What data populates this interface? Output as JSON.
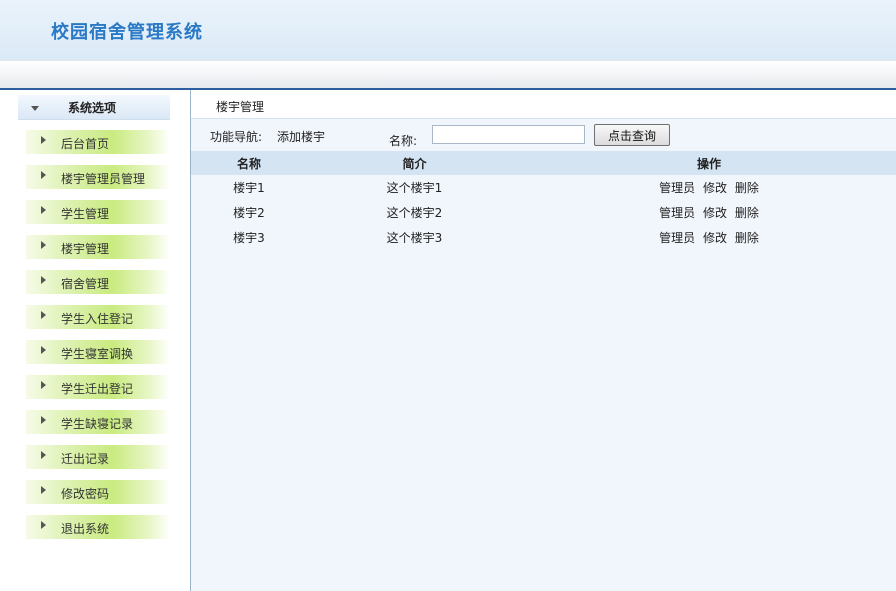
{
  "header": {
    "title": "校园宿舍管理系统"
  },
  "sidebar": {
    "title": "系统选项",
    "items": [
      {
        "label": "后台首页"
      },
      {
        "label": "楼宇管理员管理"
      },
      {
        "label": "学生管理"
      },
      {
        "label": "楼宇管理"
      },
      {
        "label": "宿舍管理"
      },
      {
        "label": "学生入住登记"
      },
      {
        "label": "学生寝室调换"
      },
      {
        "label": "学生迁出登记"
      },
      {
        "label": "学生缺寝记录"
      },
      {
        "label": "迁出记录"
      },
      {
        "label": "修改密码"
      },
      {
        "label": "退出系统"
      }
    ]
  },
  "main": {
    "breadcrumb": "楼宇管理",
    "func_nav_label": "功能导航:",
    "add_link": "添加楼宇",
    "name_label": "名称:",
    "search_value": "",
    "search_button": "点击查询",
    "table": {
      "headers": [
        "名称",
        "简介",
        "操作"
      ],
      "rows": [
        {
          "name": "楼宇1",
          "desc": "这个楼宇1",
          "ops": [
            "管理员",
            "修改",
            "删除"
          ]
        },
        {
          "name": "楼宇2",
          "desc": "这个楼宇2",
          "ops": [
            "管理员",
            "修改",
            "删除"
          ]
        },
        {
          "name": "楼宇3",
          "desc": "这个楼宇3",
          "ops": [
            "管理员",
            "修改",
            "删除"
          ]
        }
      ]
    }
  }
}
